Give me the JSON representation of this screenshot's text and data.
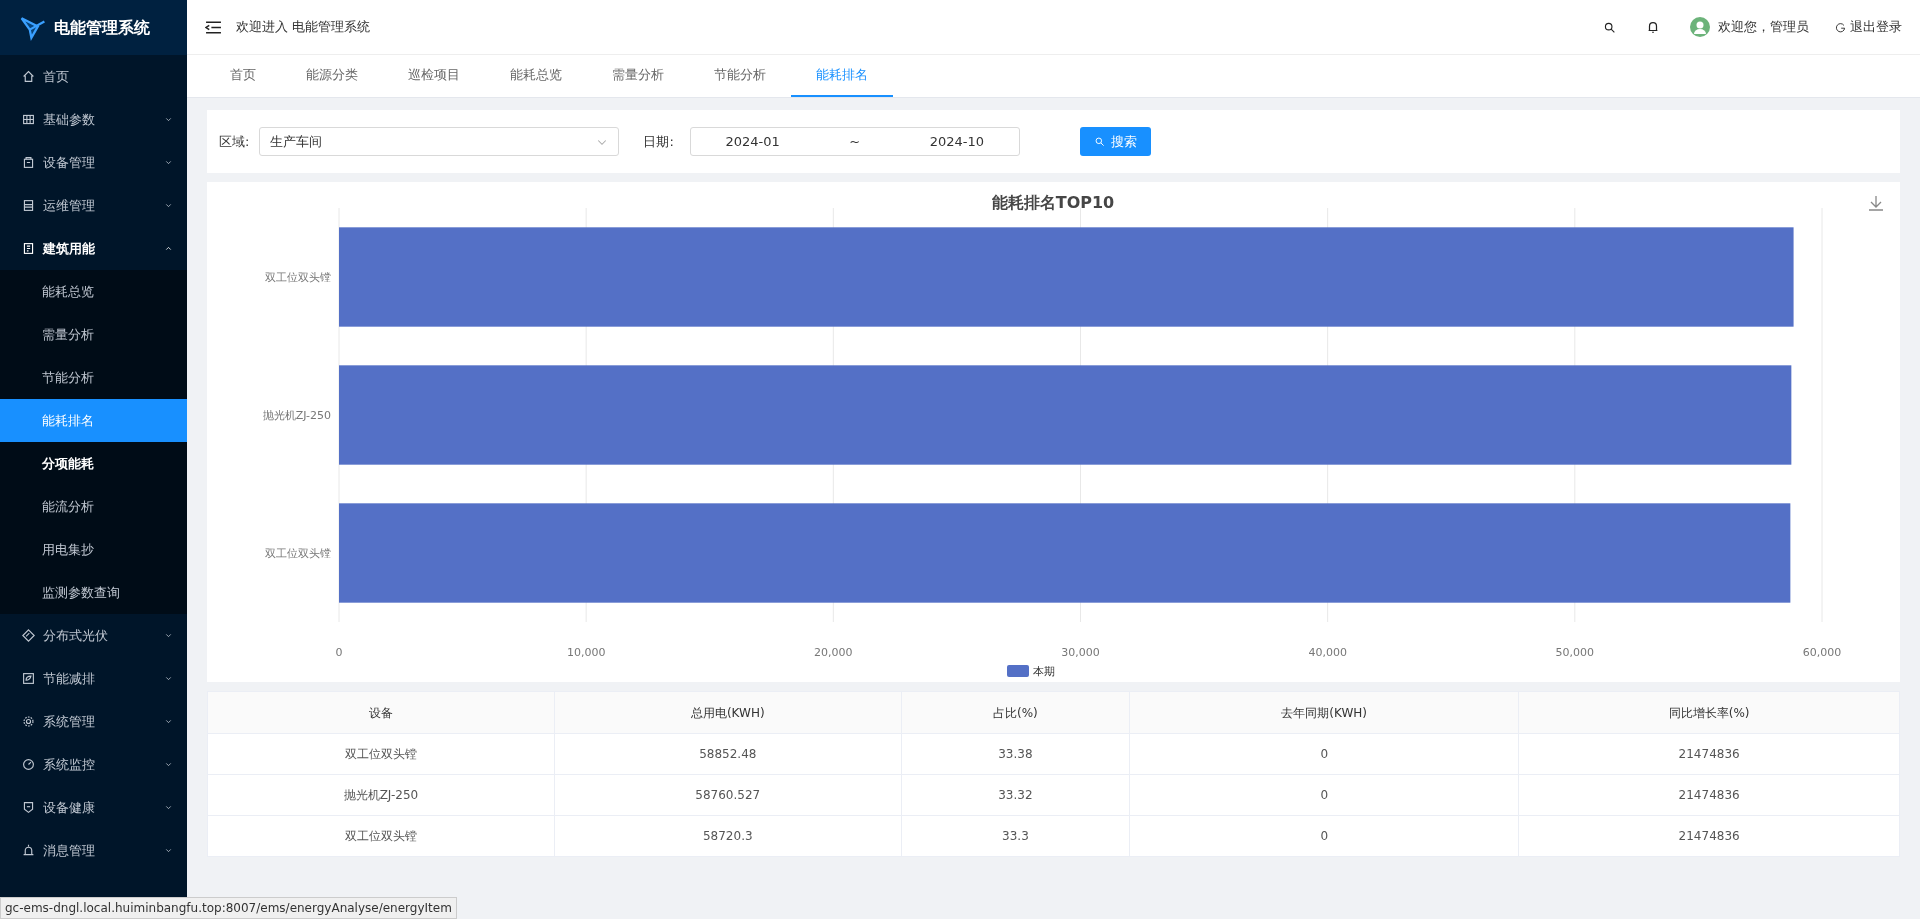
{
  "app": {
    "title": "电能管理系统"
  },
  "sidebar": {
    "items": [
      {
        "label": "首页",
        "expandable": false,
        "expanded": false
      },
      {
        "label": "基础参数",
        "expandable": true,
        "expanded": false
      },
      {
        "label": "设备管理",
        "expandable": true,
        "expanded": false
      },
      {
        "label": "运维管理",
        "expandable": true,
        "expanded": false
      },
      {
        "label": "建筑用能",
        "expandable": true,
        "expanded": true,
        "children": [
          {
            "label": "能耗总览",
            "selected": false,
            "hovered": false
          },
          {
            "label": "需量分析",
            "selected": false,
            "hovered": false
          },
          {
            "label": "节能分析",
            "selected": false,
            "hovered": false
          },
          {
            "label": "能耗排名",
            "selected": true,
            "hovered": false
          },
          {
            "label": "分项能耗",
            "selected": false,
            "hovered": true
          },
          {
            "label": "能流分析",
            "selected": false,
            "hovered": false
          },
          {
            "label": "用电集抄",
            "selected": false,
            "hovered": false
          },
          {
            "label": "监测参数查询",
            "selected": false,
            "hovered": false
          }
        ]
      },
      {
        "label": "分布式光伏",
        "expandable": true,
        "expanded": false
      },
      {
        "label": "节能减排",
        "expandable": true,
        "expanded": false
      },
      {
        "label": "系统管理",
        "expandable": true,
        "expanded": false
      },
      {
        "label": "系统监控",
        "expandable": true,
        "expanded": false
      },
      {
        "label": "设备健康",
        "expandable": true,
        "expanded": false
      },
      {
        "label": "消息管理",
        "expandable": true,
        "expanded": false
      }
    ]
  },
  "header": {
    "welcome": "欢迎进入 电能管理系统",
    "user_greeting": "欢迎您，管理员",
    "logout": "退出登录"
  },
  "tabs": [
    {
      "label": "首页",
      "selected": false
    },
    {
      "label": "能源分类",
      "selected": false
    },
    {
      "label": "巡检项目",
      "selected": false
    },
    {
      "label": "能耗总览",
      "selected": false
    },
    {
      "label": "需量分析",
      "selected": false
    },
    {
      "label": "节能分析",
      "selected": false
    },
    {
      "label": "能耗排名",
      "selected": true
    }
  ],
  "filters": {
    "area_label": "区域:",
    "area_value": "生产车间",
    "date_label": "日期:",
    "date_start": "2024-01",
    "date_separator": "~",
    "date_end": "2024-10",
    "search_button": "搜索"
  },
  "chart": {
    "chart_data": {
      "type": "bar",
      "orientation": "horizontal",
      "title": "能耗排名TOP10",
      "categories": [
        "双工位双头镗",
        "抛光机ZJ-250",
        "双工位双头镗"
      ],
      "series": [
        {
          "name": "本期",
          "color": "#5470c6",
          "values": [
            58850,
            58760,
            58720
          ]
        }
      ],
      "grid": true,
      "xlim": [
        0,
        60000
      ],
      "xticks": [
        {
          "value": 0,
          "label": "0"
        },
        {
          "value": 10000,
          "label": "10,000"
        },
        {
          "value": 20000,
          "label": "20,000"
        },
        {
          "value": 30000,
          "label": "30,000"
        },
        {
          "value": 40000,
          "label": "40,000"
        },
        {
          "value": 50000,
          "label": "50,000"
        },
        {
          "value": 60000,
          "label": "60,000"
        }
      ]
    }
  },
  "table": {
    "columns": [
      "设备",
      "总用电(KWH)",
      "占比(%)",
      "去年同期(KWH)",
      "同比增长率(%)"
    ],
    "rows": [
      [
        "双工位双头镗",
        "58852.48",
        "33.38",
        "0",
        "21474836"
      ],
      [
        "抛光机ZJ-250",
        "58760.527",
        "33.32",
        "0",
        "21474836"
      ],
      [
        "双工位双头镗",
        "58720.3",
        "33.3",
        "0",
        "21474836"
      ]
    ]
  },
  "status_bar": {
    "url": "gc-ems-dngl.local.huiminbangfu.top:8007/ems/energyAnalyse/energyItem"
  }
}
